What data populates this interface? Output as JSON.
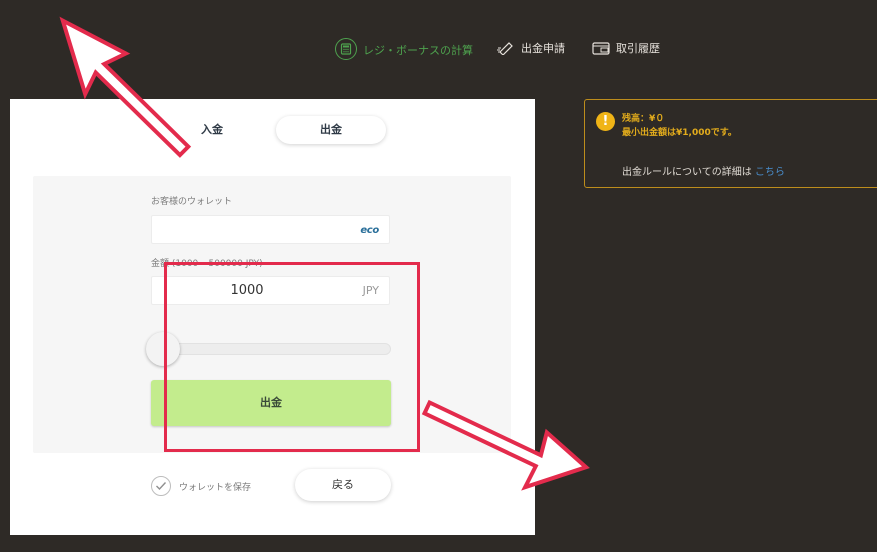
{
  "nav": {
    "calc_label": "レジ・ボーナスの計算",
    "withdraw_request_label": "出金申請",
    "history_label": "取引履歴"
  },
  "tabs": {
    "deposit": "入金",
    "withdraw": "出金"
  },
  "form": {
    "wallet_label": "お客様のウォレット",
    "wallet_brand": "eco",
    "amount_label": "金額 (1000 – 500000 JPY)",
    "amount_value": "1000",
    "currency": "JPY",
    "slider_value": 0,
    "submit_label": "出金"
  },
  "footer": {
    "save_wallet_label": "ウォレットを保存",
    "back_label": "戻る"
  },
  "info": {
    "balance": "残高：¥０",
    "min_withdraw": "最小出金額は¥1,000です。",
    "rule_text": "出金ルールについての詳細は",
    "rule_link": "こちら"
  },
  "colors": {
    "background": "#2e2a26",
    "accent_green": "#4ea24e",
    "submit_button": "#c3ec8d",
    "warning": "#f0b416",
    "highlight_red": "#e32b4c",
    "link": "#4a8fcf"
  }
}
